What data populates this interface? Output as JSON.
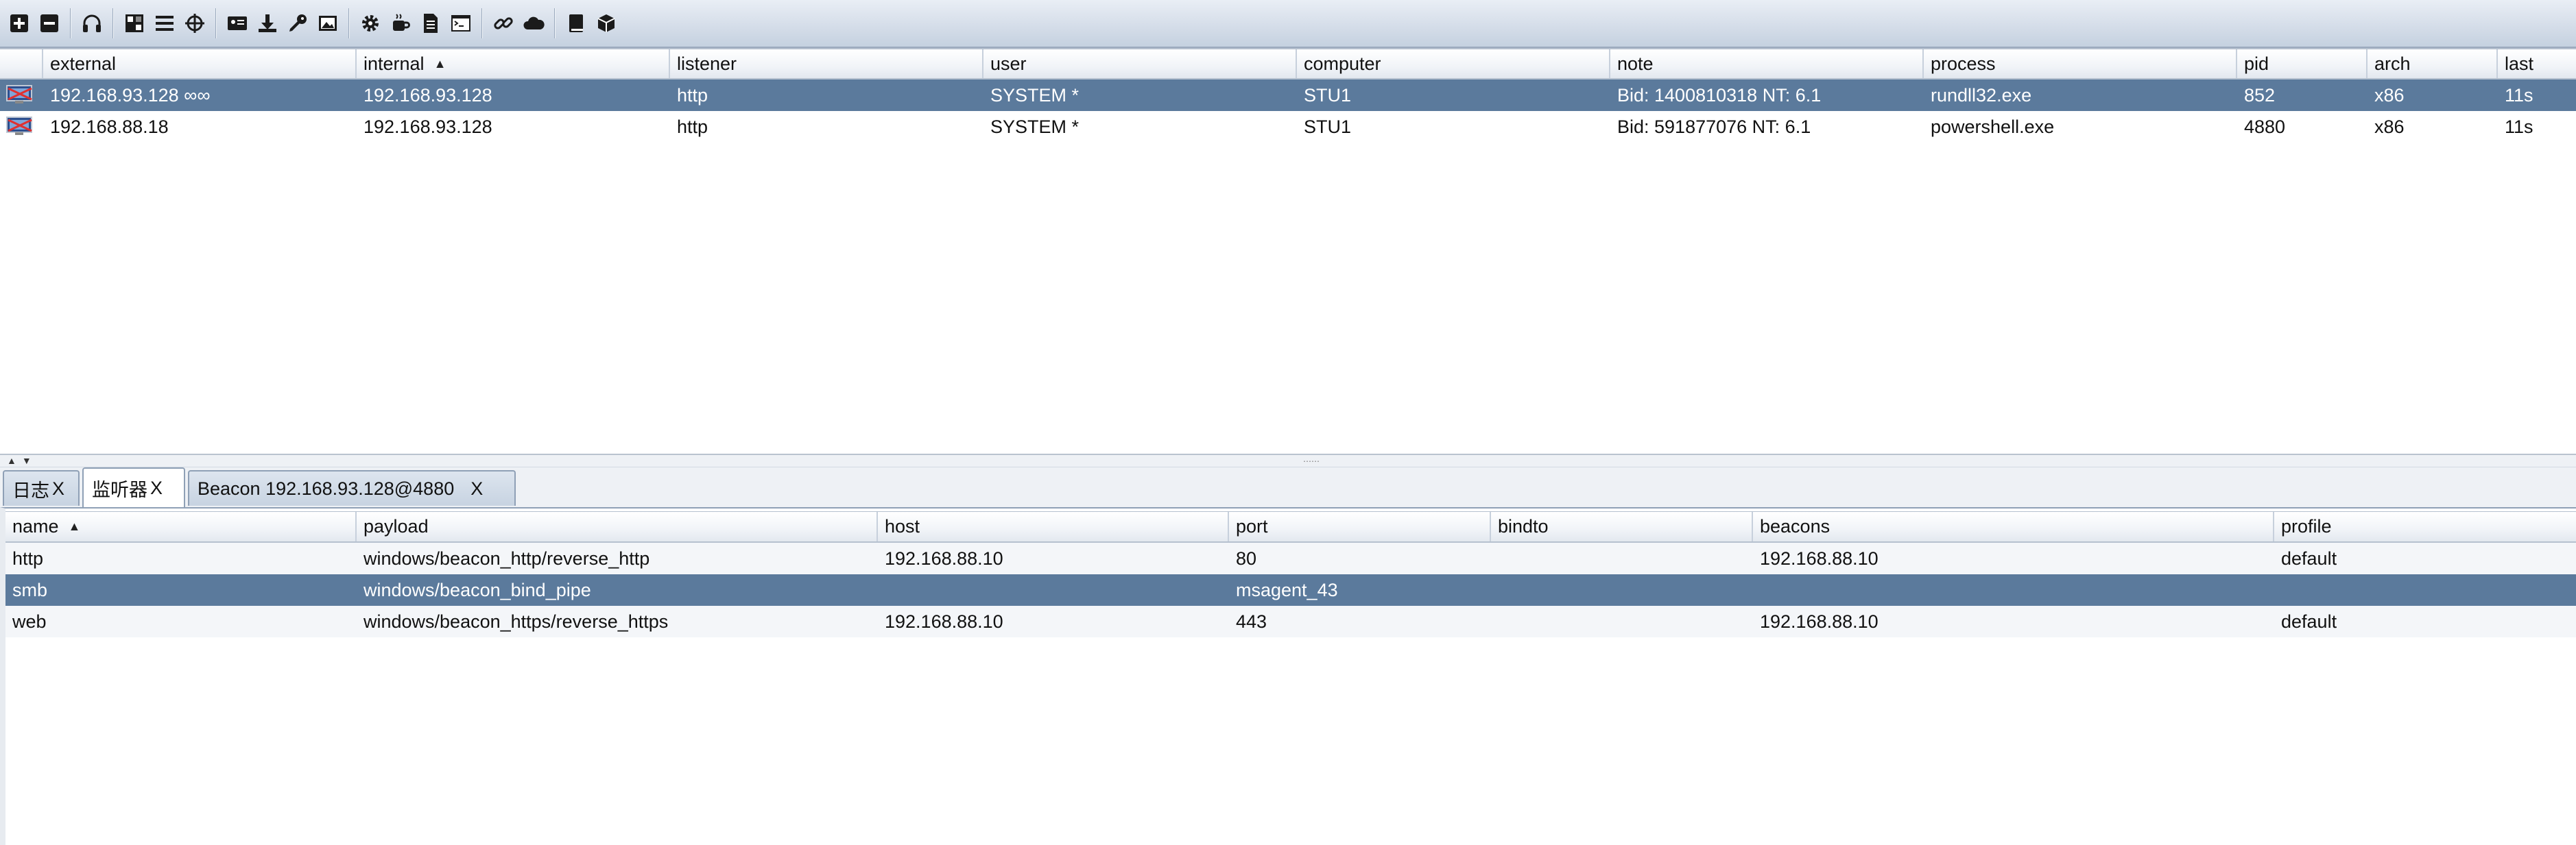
{
  "toolbar": {
    "icons": [
      "plus-icon",
      "minus-icon",
      "headphones-icon",
      "pivot-graph-icon",
      "session-table-icon",
      "target-icon",
      "credentials-icon",
      "download-icon",
      "key-icon",
      "screenshot-icon",
      "settings-icon",
      "coffee-icon",
      "document-icon",
      "console-icon",
      "link-icon",
      "cloud-icon",
      "book-icon",
      "cube-icon"
    ]
  },
  "sessions": {
    "columns": [
      {
        "label": "",
        "sort": ""
      },
      {
        "label": "external",
        "sort": ""
      },
      {
        "label": "internal",
        "sort": "▲"
      },
      {
        "label": "listener",
        "sort": ""
      },
      {
        "label": "user",
        "sort": ""
      },
      {
        "label": "computer",
        "sort": ""
      },
      {
        "label": "note",
        "sort": ""
      },
      {
        "label": "process",
        "sort": ""
      },
      {
        "label": "pid",
        "sort": ""
      },
      {
        "label": "arch",
        "sort": ""
      },
      {
        "label": "last",
        "sort": ""
      }
    ],
    "rows": [
      {
        "external": "192.168.93.128 ∞∞",
        "internal": "192.168.93.128",
        "listener": "http",
        "user": "SYSTEM *",
        "computer": "STU1",
        "note": "Bid: 1400810318  NT: 6.1",
        "process": "rundll32.exe",
        "pid": "852",
        "arch": "x86",
        "last": "11s"
      },
      {
        "external": "192.168.88.18",
        "internal": "192.168.93.128",
        "listener": "http",
        "user": "SYSTEM *",
        "computer": "STU1",
        "note": "Bid: 591877076  NT: 6.1",
        "process": "powershell.exe",
        "pid": "4880",
        "arch": "x86",
        "last": "11s"
      }
    ]
  },
  "tabs": [
    {
      "label": "日志",
      "close": "X"
    },
    {
      "label": "监听器",
      "close": "X"
    },
    {
      "label": "Beacon 192.168.93.128@4880",
      "close": "X"
    }
  ],
  "listeners": {
    "columns": [
      {
        "label": "name",
        "sort": "▲"
      },
      {
        "label": "payload",
        "sort": ""
      },
      {
        "label": "host",
        "sort": ""
      },
      {
        "label": "port",
        "sort": ""
      },
      {
        "label": "bindto",
        "sort": ""
      },
      {
        "label": "beacons",
        "sort": ""
      },
      {
        "label": "profile",
        "sort": ""
      }
    ],
    "rows": [
      {
        "name": "http",
        "payload": "windows/beacon_http/reverse_http",
        "host": "192.168.88.10",
        "port": "80",
        "bindto": "",
        "beacons": "192.168.88.10",
        "profile": "default"
      },
      {
        "name": "smb",
        "payload": "windows/beacon_bind_pipe",
        "host": "",
        "port": "msagent_43",
        "bindto": "",
        "beacons": "",
        "profile": ""
      },
      {
        "name": "web",
        "payload": "windows/beacon_https/reverse_https",
        "host": "192.168.88.10",
        "port": "443",
        "bindto": "",
        "beacons": "192.168.88.10",
        "profile": "default"
      }
    ]
  }
}
